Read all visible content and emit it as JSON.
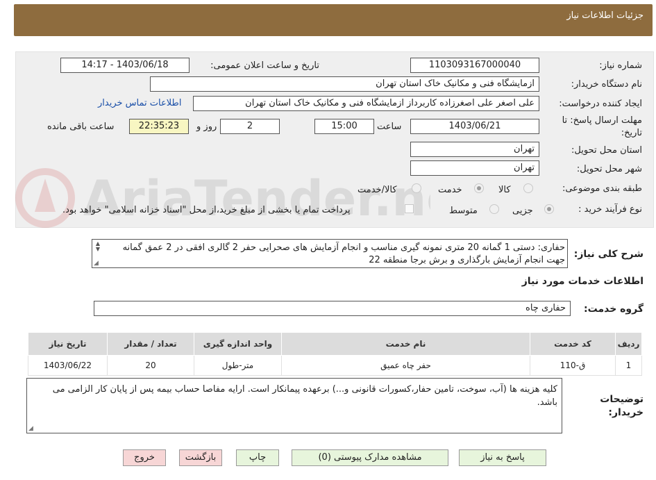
{
  "header": {
    "title": "جزئیات اطلاعات نیاز"
  },
  "form": {
    "need_number_label": "شماره نیاز:",
    "need_number": "1103093167000040",
    "announce_label": "تاریخ و ساعت اعلان عمومی:",
    "announce_value": "1403/06/18 - 14:17",
    "buyer_org_label": "نام دستگاه خریدار:",
    "buyer_org": "ازمایشگاه فنی و مکانیک خاک استان تهران",
    "requester_label": "ایجاد کننده درخواست:",
    "requester": "علی اصغر علی اصغرزاده کاربرداز ازمایشگاه فنی و مکانیک خاک استان تهران",
    "contact_link": "اطلاعات تماس خریدار",
    "deadline_label_1": "مهلت ارسال پاسخ: تا",
    "deadline_label_2": "تاریخ:",
    "deadline_date": "1403/06/21",
    "time_label": "ساعت",
    "deadline_time": "15:00",
    "days_value": "2",
    "days_label": "روز و",
    "remaining_time": "22:35:23",
    "remaining_label": "ساعت باقی مانده",
    "province_label": "استان محل تحویل:",
    "province": "تهران",
    "city_label": "شهر محل تحویل:",
    "city": "تهران",
    "category_label": "طبقه بندی موضوعی:",
    "category_options": [
      "کالا",
      "خدمت",
      "کالا/خدمت"
    ],
    "process_label": "نوع فرآیند خرید :",
    "process_options": [
      "جزیی",
      "متوسط"
    ],
    "payment_note": "پرداخت تمام یا بخشی از مبلغ خرید،از محل \"اسناد خزانه اسلامی\" خواهد بود."
  },
  "description": {
    "label": "شرح کلی نیاز:",
    "text": "حفاری: دستی 1 گمانه 20 متری نمونه گیری مناسب و انجام آزمایش های صحرایی حفر 2 گالری افقی در 2 عمق گمانه جهت انجام آزمایش بارگذاری و برش برجا منطقه 22"
  },
  "services": {
    "section_title": "اطلاعات خدمات مورد نیاز",
    "group_label": "گروه خدمت:",
    "group_value": "حفاری چاه",
    "columns": [
      "ردیف",
      "کد خدمت",
      "نام خدمت",
      "واحد اندازه گیری",
      "تعداد / مقدار",
      "تاریخ نیاز"
    ],
    "rows": [
      {
        "row": "1",
        "code": "ق-110",
        "name": "حفر چاه عمیق",
        "unit": "متر-طول",
        "qty": "20",
        "date": "1403/06/22"
      }
    ]
  },
  "notes": {
    "label_1": "توضیحات",
    "label_2": "خریدار:",
    "text": "کلیه هزینه ها (آب، سوخت، تامین حفار،کسورات قانونی و...) برعهده پیمانکار است. ارایه مفاصا حساب بیمه پس از پایان کار الزامی می باشد."
  },
  "buttons": {
    "reply": "پاسخ به نیاز",
    "attachments": "مشاهده مدارک پیوستی (0)",
    "print": "چاپ",
    "back": "بازگشت",
    "exit": "خروج"
  },
  "watermark": {
    "text": "AriaTender.neT"
  },
  "colors": {
    "header": "#8e6c3e",
    "panel": "#efefef",
    "link": "#1a4fa8",
    "remaining_bg": "#f8f6c2"
  }
}
